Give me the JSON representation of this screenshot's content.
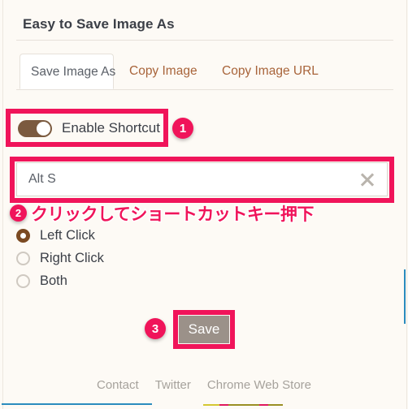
{
  "panel": {
    "title": "Easy to Save Image As"
  },
  "tabs": [
    {
      "label": "Save Image As",
      "active": true
    },
    {
      "label": "Copy Image",
      "active": false
    },
    {
      "label": "Copy Image URL",
      "active": false
    }
  ],
  "toggle": {
    "label": "Enable Shortcut",
    "state": "on",
    "track_color": "#7b5a3f",
    "knob_color": "#ffffff"
  },
  "shortcut_input": {
    "value": "Alt S",
    "placeholder": "Alt S",
    "clear_icon": "close-x-icon"
  },
  "radios": [
    {
      "label": "Left Click",
      "checked": true
    },
    {
      "label": "Right Click",
      "checked": false
    },
    {
      "label": "Both",
      "checked": false
    }
  ],
  "save_button": {
    "label": "Save",
    "bg_color": "#9b9189",
    "text_color": "#ffffff"
  },
  "footer": {
    "links": [
      {
        "label": "Contact"
      },
      {
        "label": "Twitter"
      },
      {
        "label": "Chrome Web Store"
      }
    ]
  },
  "annotations": {
    "accent_color": "#f0145a",
    "badges": [
      {
        "number": "1"
      },
      {
        "number": "2"
      },
      {
        "number": "3"
      }
    ],
    "note_jp": "クリックしてショートカットキー押下"
  },
  "decor": {
    "blue_rule_color": "#2b8cbe",
    "strip_segments": [
      {
        "color": "#cdc game",
        "width": 0
      }
    ]
  },
  "strip": [
    {
      "color": "#d4c832",
      "width": 20
    },
    {
      "color": "#e0185c",
      "width": 11
    },
    {
      "color": "#9a8f23",
      "width": 38
    },
    {
      "color": "#e0185c",
      "width": 11
    },
    {
      "color": "#9a8f23",
      "width": 18
    }
  ]
}
